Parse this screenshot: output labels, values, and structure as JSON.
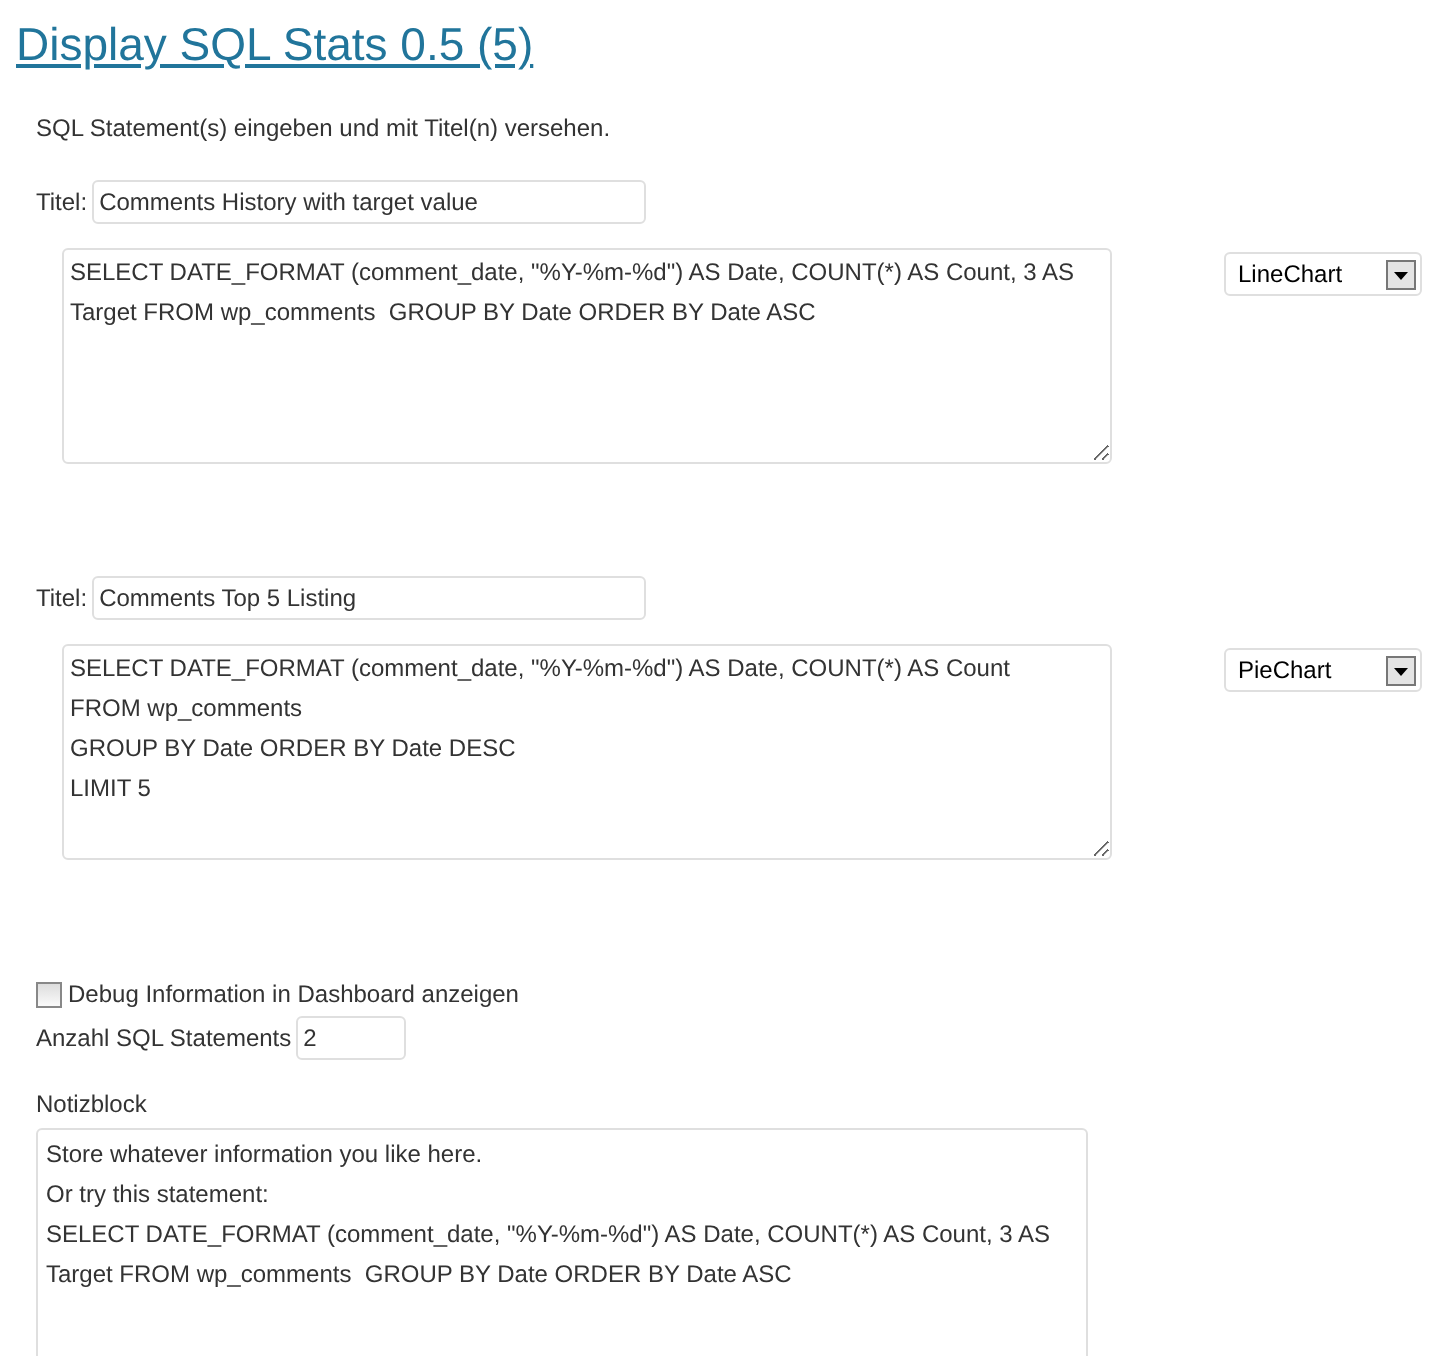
{
  "title": "Display SQL Stats 0.5 (5)",
  "intro": "SQL Statement(s) eingeben und mit Titel(n) versehen.",
  "statements": [
    {
      "title_label": "Titel:",
      "title_value": "Comments History with target value",
      "sql": "SELECT DATE_FORMAT (comment_date, \"%Y-%m-%d\") AS Date, COUNT(*) AS Count, 3 AS Target FROM wp_comments  GROUP BY Date ORDER BY Date ASC",
      "chart_type": "LineChart"
    },
    {
      "title_label": "Titel:",
      "title_value": "Comments Top 5 Listing",
      "sql": "SELECT DATE_FORMAT (comment_date, \"%Y-%m-%d\") AS Date, COUNT(*) AS Count\nFROM wp_comments\nGROUP BY Date ORDER BY Date DESC\nLIMIT 5",
      "chart_type": "PieChart"
    }
  ],
  "debug": {
    "label": "Debug Information in Dashboard anzeigen",
    "checked": false
  },
  "count": {
    "label": "Anzahl SQL Statements",
    "value": "2"
  },
  "notes": {
    "label": "Notizblock",
    "value": "Store whatever information you like here.\nOr try this statement:\nSELECT DATE_FORMAT (comment_date, \"%Y-%m-%d\") AS Date, COUNT(*) AS Count, 3 AS Target FROM wp_comments  GROUP BY Date ORDER BY Date ASC"
  }
}
